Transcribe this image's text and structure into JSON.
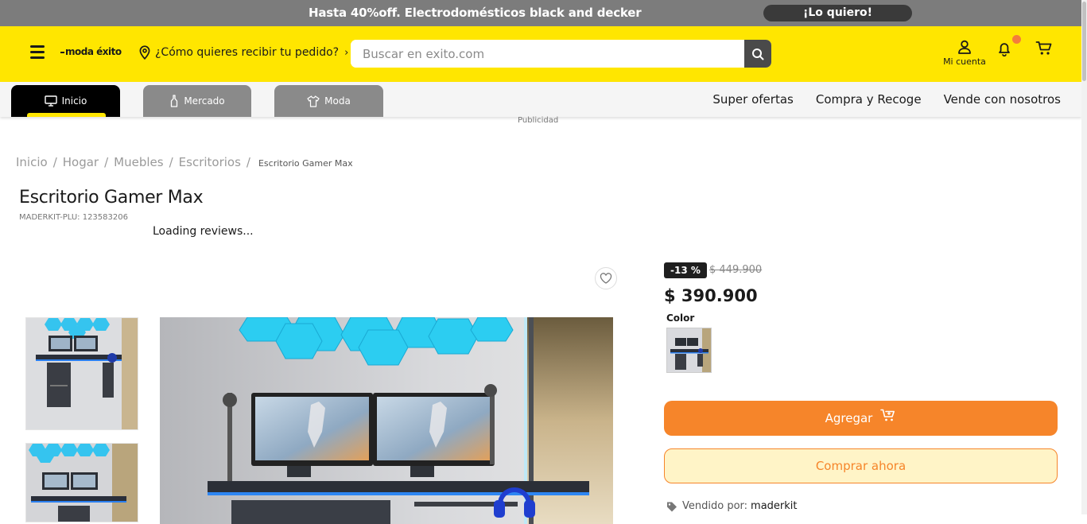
{
  "promo": {
    "text": "Hasta 40%off. Electrodomésticos black and decker",
    "cta": "¡Lo quiero!"
  },
  "header": {
    "logo": "moda éxito",
    "delivery": "¿Cómo quieres recibir tu pedido?",
    "search_placeholder": "Buscar en exito.com",
    "account_label": "Mi cuenta"
  },
  "tabs": [
    {
      "label": "Inicio",
      "icon": "monitor-icon",
      "active": true
    },
    {
      "label": "Mercado",
      "icon": "bottle-icon",
      "active": false
    },
    {
      "label": "Moda",
      "icon": "shirt-icon",
      "active": false
    }
  ],
  "nav_links": [
    "Super ofertas",
    "Compra y Recoge",
    "Vende con nosotros"
  ],
  "ad_label": "Publicidad",
  "breadcrumb": [
    "Inicio",
    "Hogar",
    "Muebles",
    "Escritorios"
  ],
  "breadcrumb_current": "Escritorio Gamer Max",
  "product": {
    "title": "Escritorio Gamer Max",
    "sku": "MADERKIT-PLU: 123583206",
    "reviews": "Loading reviews...",
    "discount": "-13 %",
    "old_price": "$ 449.900",
    "price": "$ 390.900",
    "color_label": "Color",
    "add_label": "Agregar",
    "buy_label": "Comprar ahora",
    "seller_prefix": "Vendido por:",
    "seller_name": "maderkit"
  },
  "colors": {
    "brand_yellow": "#ffe600",
    "orange": "#f6852a",
    "promo_gray": "#7c7c7c"
  }
}
